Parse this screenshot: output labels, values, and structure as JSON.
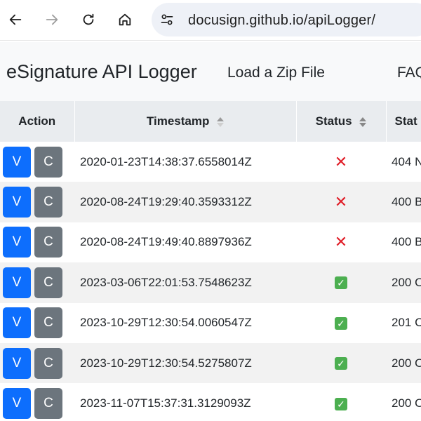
{
  "browser": {
    "url": "docusign.github.io/apiLogger/"
  },
  "header": {
    "brand": "eSignature API Logger",
    "nav_load": "Load a Zip File",
    "nav_faq": "FAQ"
  },
  "table": {
    "columns": [
      "Action",
      "Timestamp",
      "Status",
      "Stat"
    ],
    "view_label": "V",
    "copy_label": "C",
    "rows": [
      {
        "timestamp": "2020-01-23T14:38:37.6558014Z",
        "ok": false,
        "status_text": "404 N"
      },
      {
        "timestamp": "2020-08-24T19:29:40.3593312Z",
        "ok": false,
        "status_text": "400 B"
      },
      {
        "timestamp": "2020-08-24T19:49:40.8897936Z",
        "ok": false,
        "status_text": "400 B"
      },
      {
        "timestamp": "2023-03-06T22:01:53.7548623Z",
        "ok": true,
        "status_text": "200 O"
      },
      {
        "timestamp": "2023-10-29T12:30:54.0060547Z",
        "ok": true,
        "status_text": "201 C"
      },
      {
        "timestamp": "2023-10-29T12:30:54.5275807Z",
        "ok": true,
        "status_text": "200 O"
      },
      {
        "timestamp": "2023-11-07T15:37:31.3129093Z",
        "ok": true,
        "status_text": "200 O"
      }
    ]
  }
}
